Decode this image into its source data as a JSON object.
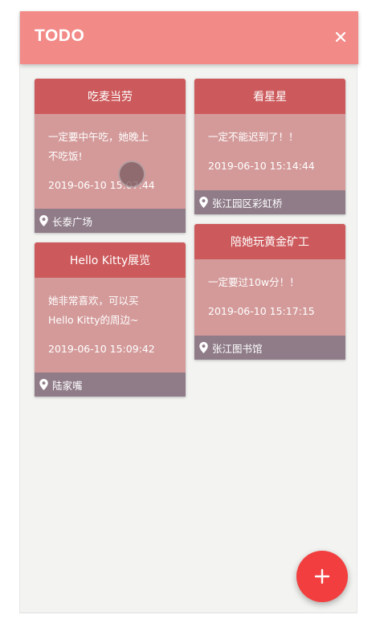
{
  "header": {
    "title": "TODO",
    "close_icon": "close-icon"
  },
  "cards": [
    {
      "title": "吃麦当劳",
      "text_line1": "一定要中午吃，她晚上",
      "text_line2": "不吃饭!",
      "time": "2019-06-10 15:07:44",
      "location": "长泰广场"
    },
    {
      "title": "看星星",
      "text_line1": "一定不能迟到了！！",
      "time": "2019-06-10 15:14:44",
      "location": "张江园区彩虹桥"
    },
    {
      "title": "Hello Kitty展览",
      "text_line1": "她非常喜欢，可以买",
      "text_line2": "Hello Kitty的周边~",
      "time": "2019-06-10 15:09:42",
      "location": "陆家嘴"
    },
    {
      "title": "陪她玩黄金矿工",
      "text_line1": "一定要过10w分！！",
      "time": "2019-06-10 15:17:15",
      "location": "张江图书馆"
    }
  ],
  "fab": {
    "icon": "plus-icon"
  },
  "colors": {
    "header": "#f28a87",
    "card_head": "#cc5a5c",
    "card_body": "#d49a9a",
    "card_foot": "#8f7c88",
    "fab": "#f23e3e",
    "background": "#f3f3f1"
  }
}
